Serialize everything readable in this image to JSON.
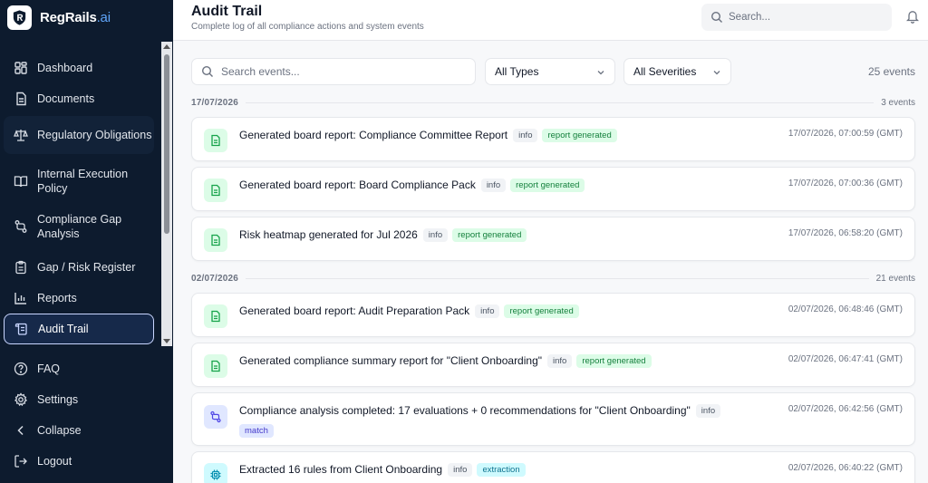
{
  "brand": {
    "name": "RegRails",
    "suffix": ".ai"
  },
  "sidebar": {
    "items": [
      {
        "label": "Dashboard",
        "icon": "dashboard-icon"
      },
      {
        "label": "Documents",
        "icon": "document-icon"
      },
      {
        "label": "Regulatory Obligations",
        "icon": "scale-icon"
      },
      {
        "label": "Internal Execution Policy",
        "icon": "book-icon"
      },
      {
        "label": "Compliance Gap Analysis",
        "icon": "git-compare-icon"
      },
      {
        "label": "Gap / Risk Register",
        "icon": "clipboard-icon"
      },
      {
        "label": "Reports",
        "icon": "bar-chart-icon"
      },
      {
        "label": "Audit Trail",
        "icon": "scroll-icon",
        "active": true
      }
    ],
    "bottom": [
      {
        "label": "FAQ",
        "icon": "help-circle-icon"
      },
      {
        "label": "Settings",
        "icon": "gear-icon"
      },
      {
        "label": "Collapse",
        "icon": "chevron-left-icon"
      },
      {
        "label": "Logout",
        "icon": "logout-icon"
      }
    ]
  },
  "header": {
    "title": "Audit Trail",
    "subtitle": "Complete log of all compliance actions and system events",
    "search_placeholder": "Search..."
  },
  "filters": {
    "search_placeholder": "Search events...",
    "type_value": "All Types",
    "severity_value": "All Severities",
    "events_count": "25 events"
  },
  "groups": [
    {
      "date": "17/07/2026",
      "count": "3 events",
      "events": [
        {
          "title": "Generated board report: Compliance Committee Report",
          "severity": "info",
          "tag": "report generated",
          "timestamp": "17/07/2026, 07:00:59 (GMT)"
        },
        {
          "title": "Generated board report: Board Compliance Pack",
          "severity": "info",
          "tag": "report generated",
          "timestamp": "17/07/2026, 07:00:36 (GMT)"
        },
        {
          "title": "Risk heatmap generated for Jul 2026",
          "severity": "info",
          "tag": "report generated",
          "timestamp": "17/07/2026, 06:58:20 (GMT)"
        }
      ]
    },
    {
      "date": "02/07/2026",
      "count": "21 events",
      "events": [
        {
          "title": "Generated board report: Audit Preparation Pack",
          "severity": "info",
          "tag": "report generated",
          "timestamp": "02/07/2026, 06:48:46 (GMT)"
        },
        {
          "title": "Generated compliance summary report for \"Client Onboarding\"",
          "severity": "info",
          "tag": "report generated",
          "timestamp": "02/07/2026, 06:47:41 (GMT)"
        },
        {
          "title": "Compliance analysis completed: 17 evaluations + 0 recommendations for \"Client Onboarding\"",
          "severity": "info",
          "tag": "match",
          "timestamp": "02/07/2026, 06:42:56 (GMT)"
        },
        {
          "title": "Extracted 16 rules from Client Onboarding",
          "severity": "info",
          "tag": "extraction",
          "timestamp": "02/07/2026, 06:40:22 (GMT)"
        }
      ]
    }
  ]
}
